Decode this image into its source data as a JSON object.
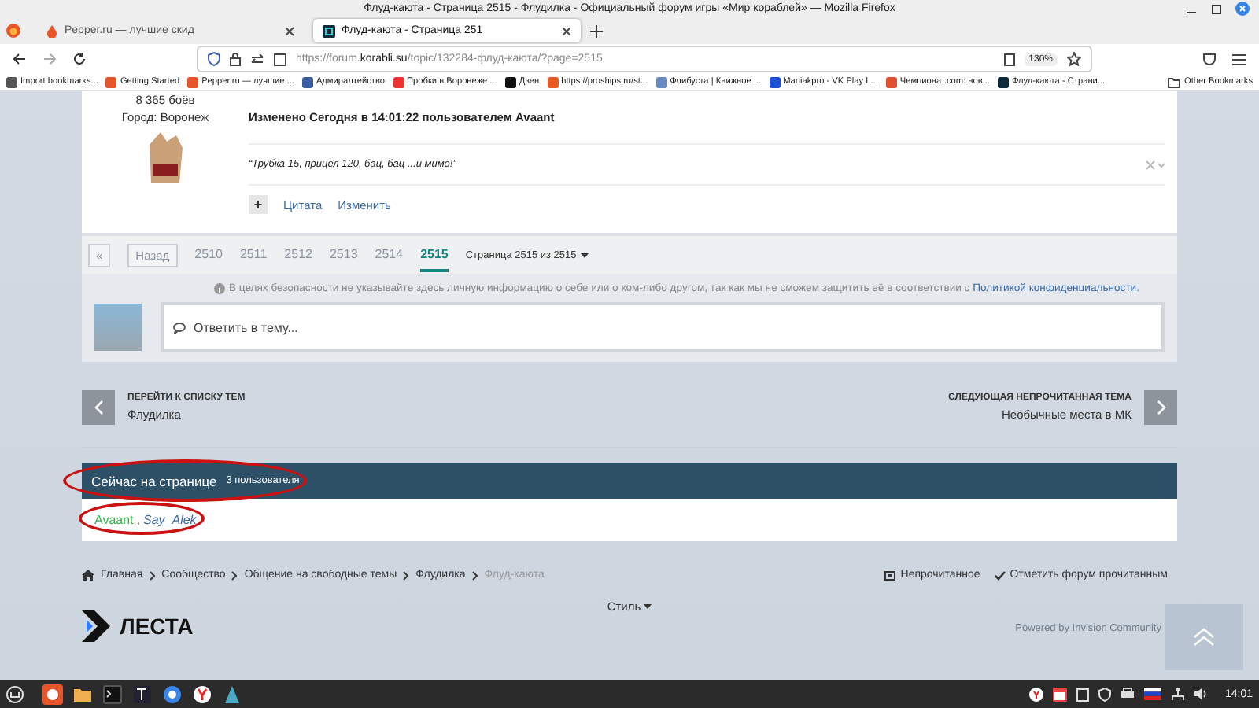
{
  "window": {
    "title": "Флуд-каюта - Страница 2515 - Флудилка - Официальный форум игры «Мир кораблей» — Mozilla Firefox"
  },
  "tabs": [
    {
      "label": "Pepper.ru — лучшие скид",
      "selected": false
    },
    {
      "label": "Флуд-каюта - Страница 251",
      "selected": true
    }
  ],
  "address": {
    "prefix": "https://forum.",
    "host": "korabli.su",
    "path": "/topic/132284-флуд-каюта/?page=2515",
    "zoom": "130%"
  },
  "bookmarks": [
    {
      "label": "Import bookmarks..."
    },
    {
      "label": "Getting Started"
    },
    {
      "label": "Pepper.ru — лучшие ..."
    },
    {
      "label": "Адмиралтейство"
    },
    {
      "label": "Пробки в Воронеже ..."
    },
    {
      "label": "Дзен"
    },
    {
      "label": "https://proships.ru/st..."
    },
    {
      "label": "Флибуста | Книжное ..."
    },
    {
      "label": "Maniakpro - VK Play L..."
    },
    {
      "label": "Чемпионат.com: нов..."
    },
    {
      "label": "Флуд-каюта - Страни..."
    }
  ],
  "other_bookmarks": "Other Bookmarks",
  "post": {
    "battles": "8 365 боёв",
    "city": "Город: Воронеж",
    "edited": "Изменено Сегодня в 14:01:22 пользователем Avaant",
    "signature": "“Трубка 15, прицел 120, бац, бац ...и мимо!”",
    "plus": "+",
    "actions": [
      "Цитата",
      "Изменить"
    ]
  },
  "pagination": {
    "first": "«",
    "back": "Назад",
    "pages": [
      {
        "label": "2510",
        "selected": false
      },
      {
        "label": "2511",
        "selected": false
      },
      {
        "label": "2512",
        "selected": false
      },
      {
        "label": "2513",
        "selected": false
      },
      {
        "label": "2514",
        "selected": false
      },
      {
        "label": "2515",
        "selected": true
      }
    ],
    "page_menu": "Страница 2515 из 2515"
  },
  "notice": {
    "text": "В целях безопасности не указывайте здесь личную информацию о себе или о ком-либо другом, так как мы не сможем защитить её в соответствии с",
    "link": "Политикой конфиденциальности",
    "end": "."
  },
  "reply": {
    "placeholder": "Ответить в тему..."
  },
  "topic_nav": {
    "prev": {
      "label": "ПЕРЕЙТИ К СПИСКУ ТЕМ",
      "title": "Флудилка"
    },
    "next": {
      "label": "СЛЕДУЮЩАЯ НЕПРОЧИТАННАЯ ТЕМА",
      "title": "Необычные места в МК"
    }
  },
  "online": {
    "title": "Сейчас на странице",
    "count": "3 пользователя",
    "circled": true,
    "users_circled": true,
    "users": [
      {
        "name": "Avaant",
        "color": "#2eb84b"
      },
      {
        "name": "Say_Alek",
        "color": "#3d6aa6"
      }
    ],
    "separator": ","
  },
  "breadcrumbs": [
    {
      "label": "Главная",
      "current": false
    },
    {
      "label": "Сообщество",
      "current": false
    },
    {
      "label": "Общение на свободные темы",
      "current": false
    },
    {
      "label": "Флудилка",
      "current": false
    },
    {
      "label": "Флуд-каюта",
      "current": true
    }
  ],
  "footer_links": [
    "Непрочитанное",
    "Отметить форум прочитанным"
  ],
  "style_menu": "Стиль",
  "logo": "ЛЕСТА",
  "powered": "Powered by Invision Community",
  "taskbar": {
    "clock": "14:01"
  }
}
